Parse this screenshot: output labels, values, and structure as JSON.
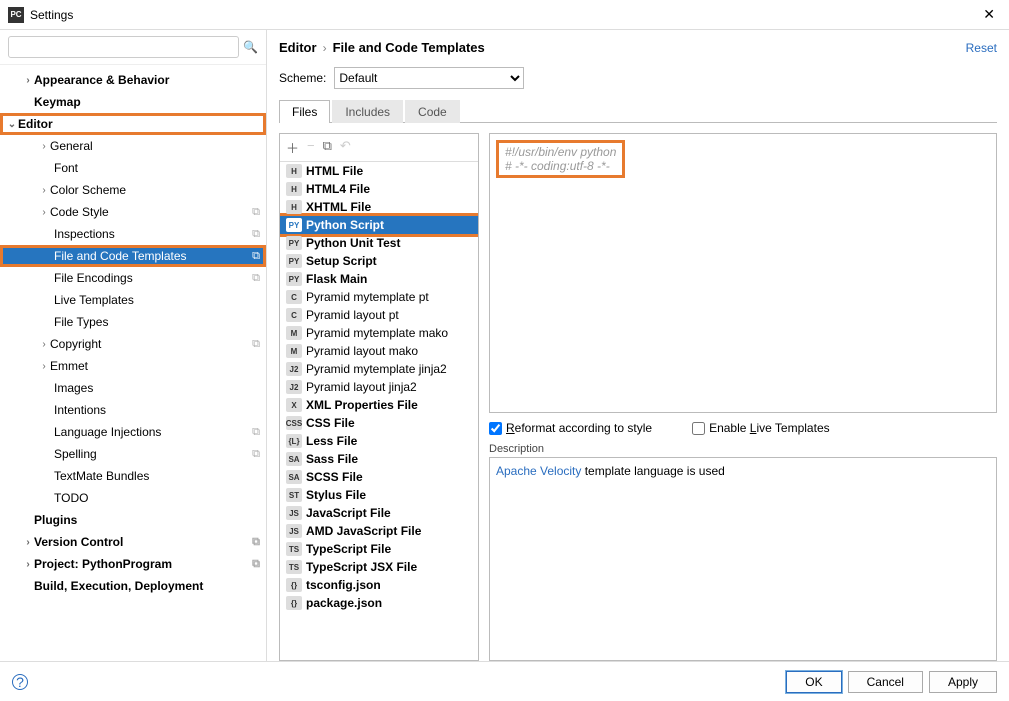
{
  "window": {
    "title": "Settings"
  },
  "search": {
    "placeholder": ""
  },
  "tree": {
    "appearance": "Appearance & Behavior",
    "keymap": "Keymap",
    "editor": "Editor",
    "general": "General",
    "font": "Font",
    "color_scheme": "Color Scheme",
    "code_style": "Code Style",
    "inspections": "Inspections",
    "file_code_templates": "File and Code Templates",
    "file_encodings": "File Encodings",
    "live_templates": "Live Templates",
    "file_types": "File Types",
    "copyright": "Copyright",
    "emmet": "Emmet",
    "images": "Images",
    "intentions": "Intentions",
    "language_injections": "Language Injections",
    "spelling": "Spelling",
    "textmate": "TextMate Bundles",
    "todo": "TODO",
    "plugins": "Plugins",
    "version_control": "Version Control",
    "project": "Project: PythonProgram",
    "build": "Build, Execution, Deployment"
  },
  "breadcrumb": {
    "a": "Editor",
    "b": "File and Code Templates",
    "reset": "Reset"
  },
  "scheme": {
    "label": "Scheme:",
    "value": "Default"
  },
  "tabs": {
    "files": "Files",
    "includes": "Includes",
    "code": "Code"
  },
  "templates": [
    {
      "label": "HTML File",
      "bold": true,
      "badge": "H"
    },
    {
      "label": "HTML4 File",
      "bold": true,
      "badge": "H"
    },
    {
      "label": "XHTML File",
      "bold": true,
      "badge": "H"
    },
    {
      "label": "Python Script",
      "bold": true,
      "badge": "PY",
      "sel": true
    },
    {
      "label": "Python Unit Test",
      "bold": true,
      "badge": "PY"
    },
    {
      "label": "Setup Script",
      "bold": true,
      "badge": "PY"
    },
    {
      "label": "Flask Main",
      "bold": true,
      "badge": "PY"
    },
    {
      "label": "Pyramid mytemplate pt",
      "bold": false,
      "badge": "C"
    },
    {
      "label": "Pyramid layout pt",
      "bold": false,
      "badge": "C"
    },
    {
      "label": "Pyramid mytemplate mako",
      "bold": false,
      "badge": "M"
    },
    {
      "label": "Pyramid layout mako",
      "bold": false,
      "badge": "M"
    },
    {
      "label": "Pyramid mytemplate jinja2",
      "bold": false,
      "badge": "J2"
    },
    {
      "label": "Pyramid layout jinja2",
      "bold": false,
      "badge": "J2"
    },
    {
      "label": "XML Properties File",
      "bold": true,
      "badge": "X"
    },
    {
      "label": "CSS File",
      "bold": true,
      "badge": "CSS"
    },
    {
      "label": "Less File",
      "bold": true,
      "badge": "{L}"
    },
    {
      "label": "Sass File",
      "bold": true,
      "badge": "SA"
    },
    {
      "label": "SCSS File",
      "bold": true,
      "badge": "SA"
    },
    {
      "label": "Stylus File",
      "bold": true,
      "badge": "ST"
    },
    {
      "label": "JavaScript File",
      "bold": true,
      "badge": "JS"
    },
    {
      "label": "AMD JavaScript File",
      "bold": true,
      "badge": "JS"
    },
    {
      "label": "TypeScript File",
      "bold": true,
      "badge": "TS"
    },
    {
      "label": "TypeScript JSX File",
      "bold": true,
      "badge": "TS"
    },
    {
      "label": "tsconfig.json",
      "bold": true,
      "badge": "{}"
    },
    {
      "label": "package.json",
      "bold": true,
      "badge": "{}"
    }
  ],
  "code": {
    "line1": "#!/usr/bin/env python",
    "line2": "# -*- coding:utf-8 -*-"
  },
  "opts": {
    "reformat": "Reformat according to style",
    "live": "Enable Live Templates"
  },
  "desc": {
    "label": "Description",
    "link": "Apache Velocity",
    "rest": " template language is used"
  },
  "footer": {
    "ok": "OK",
    "cancel": "Cancel",
    "apply": "Apply"
  }
}
